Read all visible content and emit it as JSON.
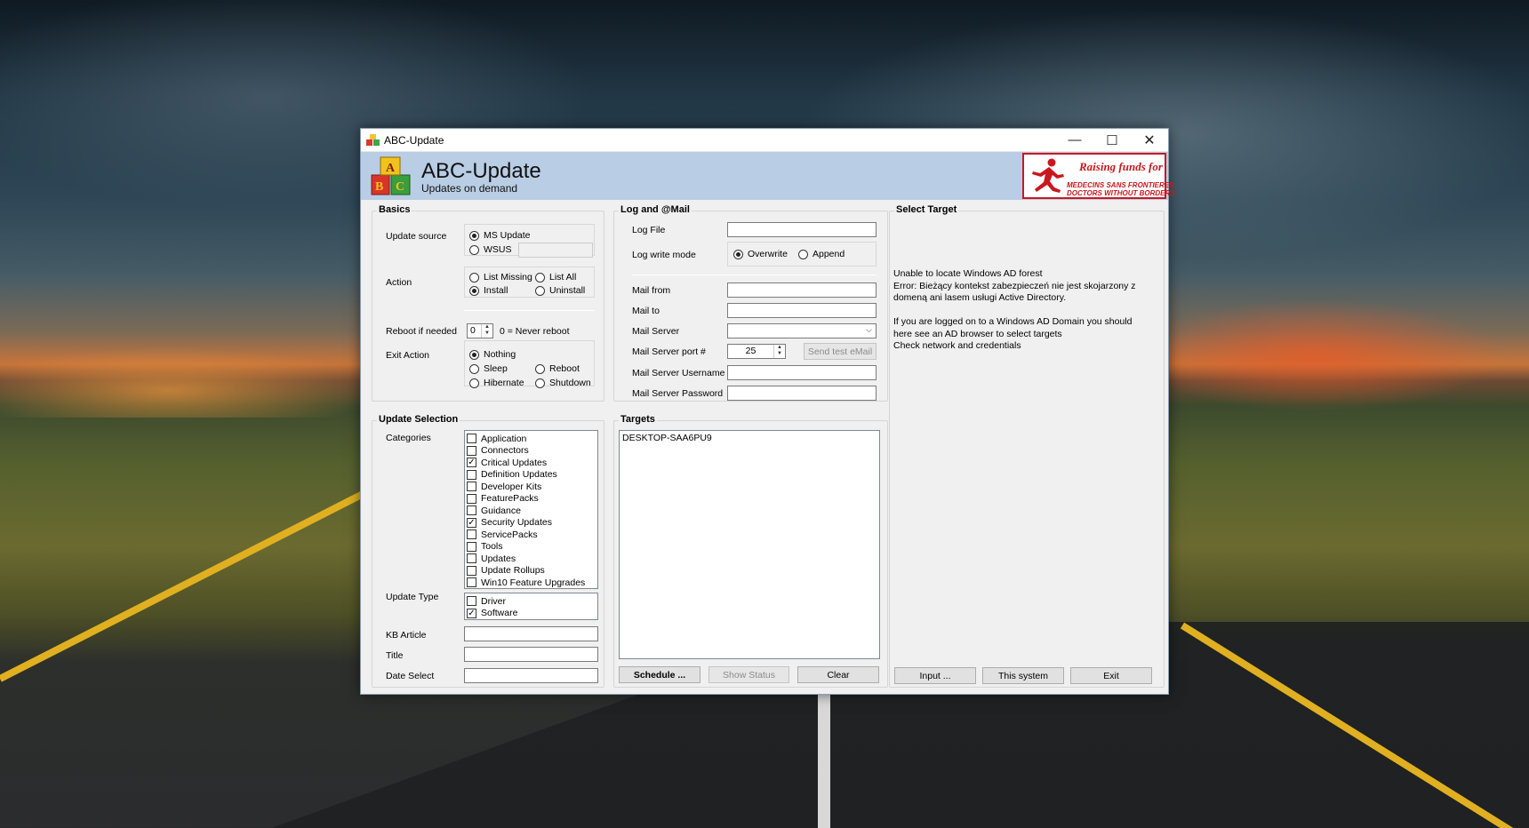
{
  "window": {
    "title": "ABC-Update",
    "minimize": "—",
    "maximize": "☐",
    "close": "✕"
  },
  "header": {
    "title": "ABC-Update",
    "subtitle": "Updates on demand",
    "banner": {
      "raising": "Raising funds for",
      "line1": "MEDECINS SANS FRONTIERES",
      "line2": "DOCTORS WITHOUT BORDERS"
    }
  },
  "basics": {
    "group_label": "Basics",
    "update_source_label": "Update source",
    "source_options": {
      "ms_update": "MS Update",
      "wsus": "WSUS"
    },
    "wsus_value": "",
    "action_label": "Action",
    "action_options": {
      "list_missing": "List Missing",
      "list_all": "List All",
      "install": "Install",
      "uninstall": "Uninstall"
    },
    "reboot_label": "Reboot if needed",
    "reboot_value": "0",
    "reboot_hint": "0 = Never reboot",
    "exit_action_label": "Exit Action",
    "exit_options": {
      "nothing": "Nothing",
      "sleep": "Sleep",
      "reboot": "Reboot",
      "hibernate": "Hibernate",
      "shutdown": "Shutdown"
    }
  },
  "log_mail": {
    "group_label": "Log  and  @Mail",
    "log_file_label": "Log File",
    "log_file_value": "",
    "log_write_mode_label": "Log write mode",
    "write_modes": {
      "overwrite": "Overwrite",
      "append": "Append"
    },
    "mail_from_label": "Mail from",
    "mail_from_value": "",
    "mail_to_label": "Mail to",
    "mail_to_value": "",
    "mail_server_label": "Mail Server",
    "mail_server_value": "",
    "mail_port_label": "Mail Server port #",
    "mail_port_value": "25",
    "send_test_label": "Send test eMail",
    "username_label": "Mail Server Username",
    "username_value": "",
    "password_label": "Mail Server Password",
    "password_value": ""
  },
  "select_target": {
    "group_label": "Select Target",
    "message": "Unable to locate Windows AD forest\nError: Bieżący kontekst zabezpieczeń nie jest skojarzony z\ndomeną ani lasem usługi Active Directory.\n\nIf you are logged on to a Windows AD Domain you should\nhere see an AD browser to select targets\nCheck network and credentials",
    "buttons": {
      "input": "Input ...",
      "this_system": "This system",
      "exit": "Exit"
    }
  },
  "update_selection": {
    "group_label": "Update Selection",
    "categories_label": "Categories",
    "categories": [
      {
        "label": "Application",
        "checked": false
      },
      {
        "label": "Connectors",
        "checked": false
      },
      {
        "label": "Critical Updates",
        "checked": true
      },
      {
        "label": "Definition Updates",
        "checked": false
      },
      {
        "label": "Developer Kits",
        "checked": false
      },
      {
        "label": "FeaturePacks",
        "checked": false
      },
      {
        "label": "Guidance",
        "checked": false
      },
      {
        "label": "Security Updates",
        "checked": true
      },
      {
        "label": "ServicePacks",
        "checked": false
      },
      {
        "label": "Tools",
        "checked": false
      },
      {
        "label": "Updates",
        "checked": false
      },
      {
        "label": "Update Rollups",
        "checked": false
      },
      {
        "label": "Win10 Feature Upgrades",
        "checked": false
      }
    ],
    "update_type_label": "Update Type",
    "update_types": [
      {
        "label": "Driver",
        "checked": false
      },
      {
        "label": "Software",
        "checked": true
      }
    ],
    "kb_article_label": "KB Article",
    "kb_article_value": "",
    "title_label": "Title",
    "title_value": "",
    "date_select_label": "Date Select",
    "date_select_value": ""
  },
  "targets": {
    "group_label": "Targets",
    "items": [
      "DESKTOP-SAA6PU9"
    ],
    "buttons": {
      "schedule": "Schedule ...",
      "show_status": "Show Status",
      "clear": "Clear"
    }
  },
  "colors": {
    "header_bg": "#b9cde4",
    "window_bg": "#f0f0f0",
    "msf_red": "#c8181e"
  }
}
